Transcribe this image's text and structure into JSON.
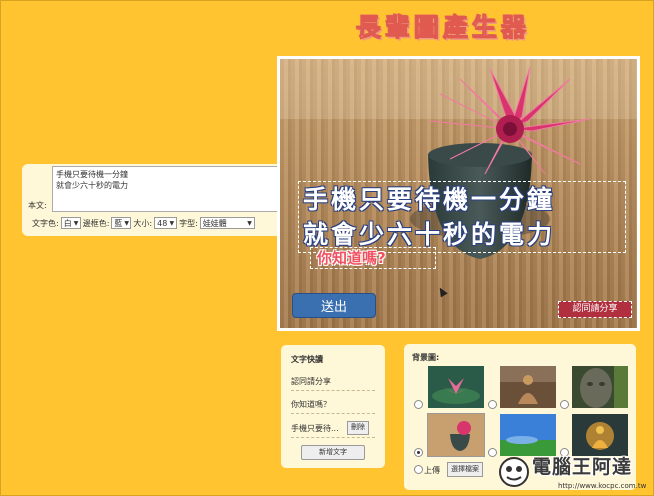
{
  "app": {
    "title": "長輩圖產生器"
  },
  "editor": {
    "body_label": "本文:",
    "body_text": "手機只要待機一分鐘\n就會少六十秒的電力",
    "text_color_label": "文字色:",
    "text_color_value": "白",
    "border_color_label": "邊框色:",
    "border_color_value": "藍",
    "size_label": "大小:",
    "size_value": "48",
    "font_label": "字型:",
    "font_value": "娃娃體"
  },
  "preview": {
    "main_line1": "手機只要待機一分鐘",
    "main_line2": "就會少六十秒的電力",
    "sub_text": "你知道嗎?",
    "credit_text": "認同請分享",
    "submit_label": "送出"
  },
  "quick_text": {
    "title": "文字快讀",
    "items": [
      "認同請分享",
      "你知道嗎？",
      "手機只要待..."
    ],
    "delete_label": "刪除",
    "add_label": "新增文字"
  },
  "background": {
    "title": "背景圖:",
    "selected_index": 3,
    "upload_label": "上傳",
    "choose_file_label": "選擇檔案"
  },
  "watermark": {
    "title": "電腦王阿達",
    "url": "http://www.kocpc.com.tw"
  },
  "colors": {
    "page_bg": "#ffc430",
    "panel_bg": "#fff8d8",
    "submit_bg": "#3a6fb0",
    "title_color": "#e05a50"
  }
}
